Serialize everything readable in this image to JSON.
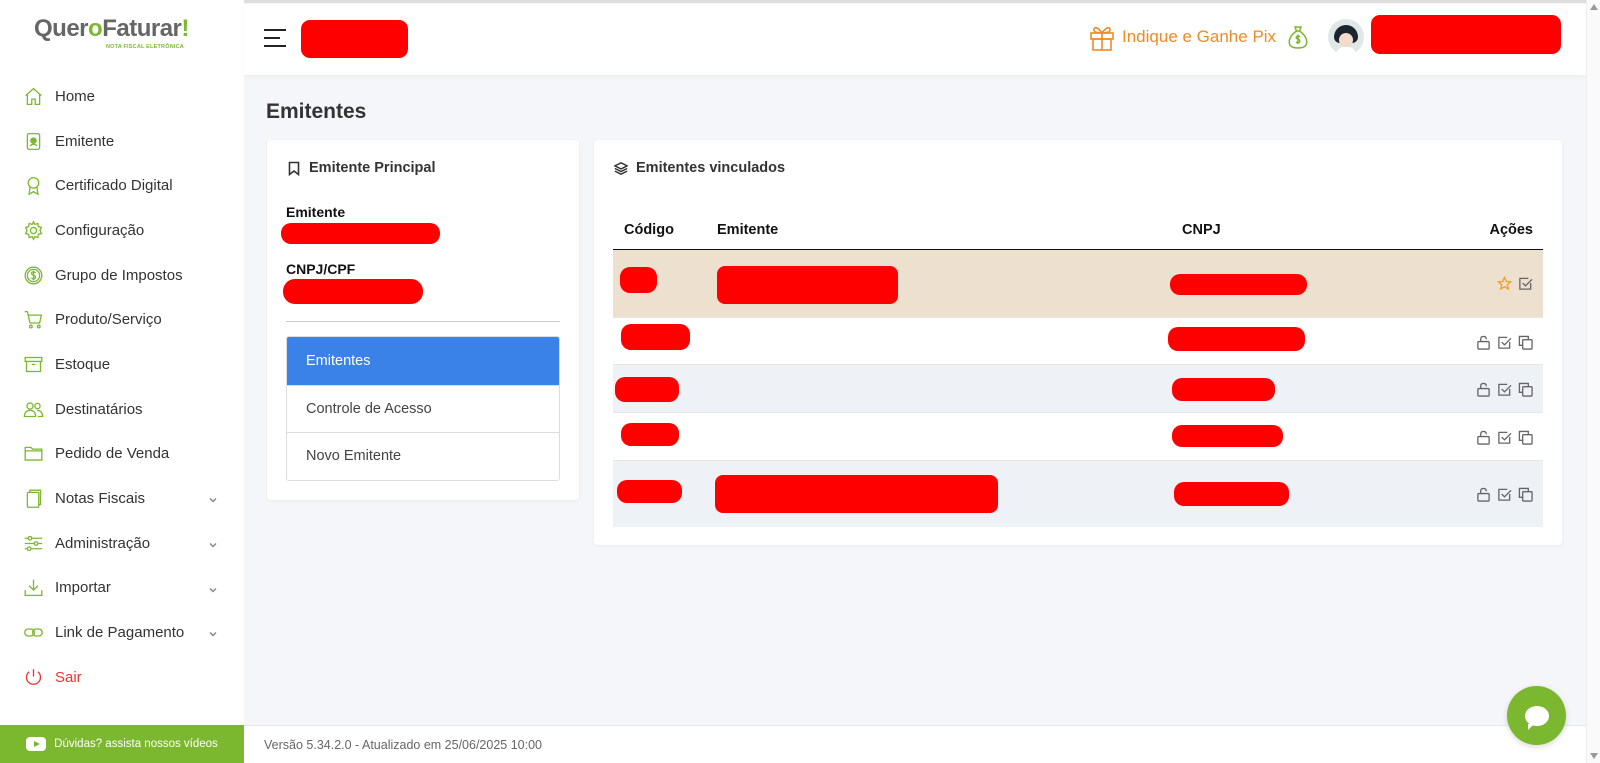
{
  "app": {
    "logo_text_a": "Quer",
    "logo_text_b": "o",
    "logo_text_c": "Faturar",
    "logo_text_d": "!",
    "logo_sub": "NOTA FISCAL ELETRÔNICA"
  },
  "sidebar": {
    "items": [
      {
        "label": "Home",
        "icon": "home-icon"
      },
      {
        "label": "Emitente",
        "icon": "id-badge-icon"
      },
      {
        "label": "Certificado Digital",
        "icon": "award-icon"
      },
      {
        "label": "Configuração",
        "icon": "gear-icon"
      },
      {
        "label": "Grupo de Impostos",
        "icon": "dollar-icon"
      },
      {
        "label": "Produto/Serviço",
        "icon": "cart-icon"
      },
      {
        "label": "Estoque",
        "icon": "archive-icon"
      },
      {
        "label": "Destinatários",
        "icon": "users-icon"
      },
      {
        "label": "Pedido de Venda",
        "icon": "folder-icon"
      },
      {
        "label": "Notas Fiscais",
        "icon": "documents-icon"
      },
      {
        "label": "Administração",
        "icon": "sliders-icon"
      },
      {
        "label": "Importar",
        "icon": "download-icon"
      },
      {
        "label": "Link de Pagamento",
        "icon": "link-icon"
      },
      {
        "label": "Sair",
        "icon": "power-icon"
      }
    ],
    "help_label": "Dúvidas? assista nossos vídeos"
  },
  "topbar": {
    "promo_label": "Indique e Ganhe Pix"
  },
  "page": {
    "title": "Emitentes"
  },
  "principal": {
    "heading": "Emitente Principal",
    "emitente_label": "Emitente",
    "cnpj_label": "CNPJ/CPF",
    "menu": [
      "Emitentes",
      "Controle de Acesso",
      "Novo Emitente"
    ]
  },
  "vinculados": {
    "heading": "Emitentes vinculados",
    "columns": {
      "codigo": "Código",
      "emitente": "Emitente",
      "cnpj": "CNPJ",
      "acoes": "Ações"
    }
  },
  "footer": {
    "version": "Versão 5.34.2.0 - Atualizado em 25/06/2025 10:00"
  },
  "colors": {
    "brand_green": "#7cb82f",
    "promo_orange": "#f08a24",
    "active_blue": "#3b82e8",
    "exit_red": "#e33333",
    "highlight_row": "#ede0cf"
  }
}
